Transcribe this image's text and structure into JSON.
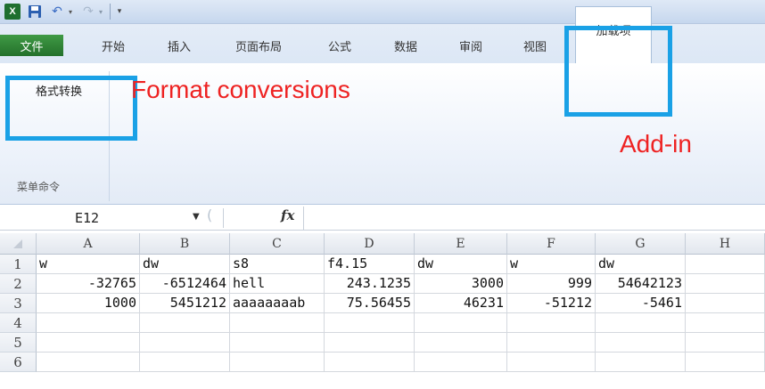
{
  "title_bar": {
    "excel_icon": "excel-icon",
    "quick_access": [
      "save-icon",
      "undo-icon",
      "redo-icon",
      "customize-icon"
    ]
  },
  "tabs": [
    "文件",
    "开始",
    "插入",
    "页面布局",
    "公式",
    "数据",
    "审阅",
    "视图",
    "加载项"
  ],
  "active_tab": "加载项",
  "ribbon": {
    "button_label": "格式转换",
    "group_label": "菜单命令"
  },
  "annotations": {
    "format": "Format conversions",
    "addin": "Add-in",
    "color": "#ee2222",
    "box_color": "#1aa1e6"
  },
  "formula_bar": {
    "name_box": "E12",
    "fx_label": "fx",
    "value": ""
  },
  "grid": {
    "columns": [
      "A",
      "B",
      "C",
      "D",
      "E",
      "F",
      "G",
      "H"
    ],
    "row_numbers": [
      "1",
      "2",
      "3",
      "4",
      "5",
      "6"
    ],
    "rows": [
      [
        "w",
        "dw",
        "s8",
        "f4.15",
        "dw",
        "w",
        "dw",
        ""
      ],
      [
        "-32765",
        "-6512464",
        "hell",
        "243.1235",
        "3000",
        "999",
        "54642123",
        ""
      ],
      [
        "1000",
        "5451212",
        "aaaaaaaab",
        "75.56455",
        "46231",
        "-51212",
        "-5461",
        ""
      ],
      [
        "",
        "",
        "",
        "",
        "",
        "",
        "",
        ""
      ],
      [
        "",
        "",
        "",
        "",
        "",
        "",
        "",
        ""
      ],
      [
        "",
        "",
        "",
        "",
        "",
        "",
        "",
        ""
      ]
    ]
  }
}
